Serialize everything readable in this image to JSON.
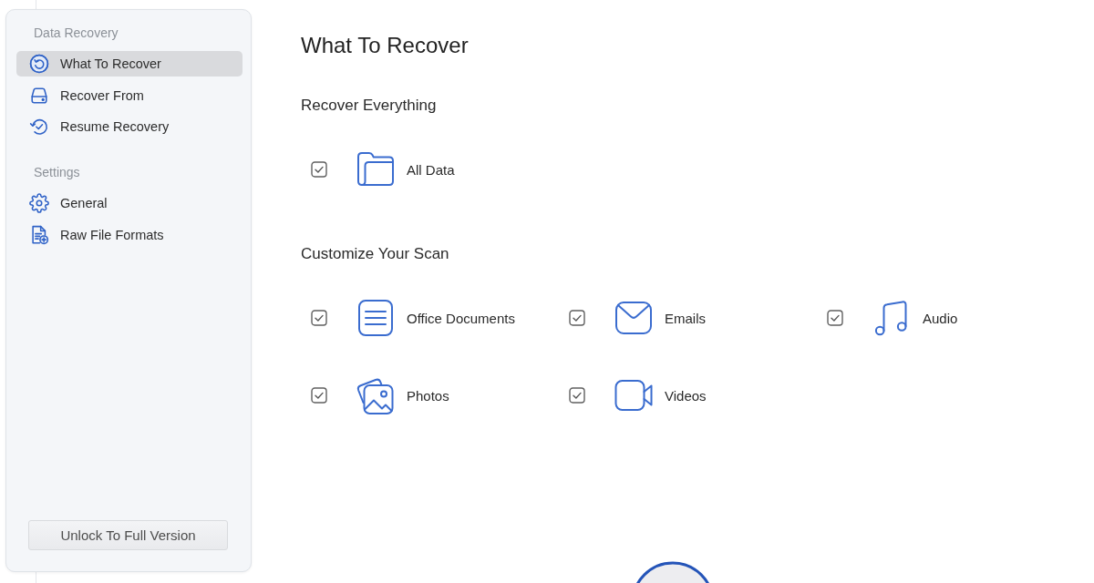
{
  "sidebar": {
    "sections": [
      {
        "heading": "Data Recovery",
        "items": [
          {
            "label": "What To Recover",
            "selected": true
          },
          {
            "label": "Recover From",
            "selected": false
          },
          {
            "label": "Resume Recovery",
            "selected": false
          }
        ]
      },
      {
        "heading": "Settings",
        "items": [
          {
            "label": "General",
            "selected": false
          },
          {
            "label": "Raw File Formats",
            "selected": false
          }
        ]
      }
    ],
    "unlock_button": "Unlock To Full Version"
  },
  "main": {
    "title": "What To Recover",
    "groups": [
      {
        "heading": "Recover Everything",
        "options": [
          {
            "label": "All Data",
            "checked": true
          }
        ]
      },
      {
        "heading": "Customize Your Scan",
        "options": [
          {
            "label": "Office Documents",
            "checked": true
          },
          {
            "label": "Emails",
            "checked": true
          },
          {
            "label": "Audio",
            "checked": true
          },
          {
            "label": "Photos",
            "checked": true
          },
          {
            "label": "Videos",
            "checked": true
          }
        ]
      }
    ]
  }
}
